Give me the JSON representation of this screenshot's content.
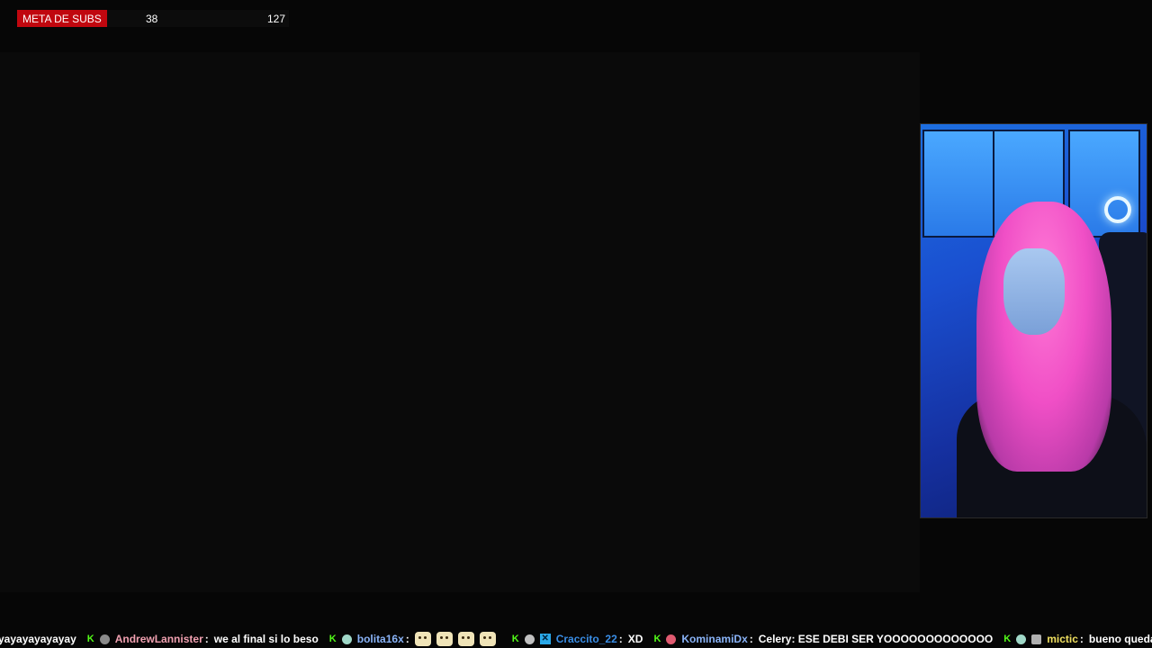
{
  "subgoal": {
    "label": "META DE SUBS",
    "current": "38",
    "target": "127",
    "progress_fraction": 0.3,
    "accent_color": "#c0070f"
  },
  "webcam": {
    "icon": "webcam-feed"
  },
  "chat": {
    "messages": [
      {
        "text": "yayayayayayay"
      },
      {
        "badges": [
          "kick-badge",
          "avatar-badge"
        ],
        "user": "AndrewLannister",
        "user_color": "#f0a0b0",
        "text": "we al final si lo beso"
      },
      {
        "badges": [
          "kick-badge",
          "globe-badge"
        ],
        "user": "bolita16x",
        "user_color": "#8ab4f8",
        "emotes": [
          "face-emote",
          "face-emote",
          "face-emote",
          "face-emote"
        ],
        "text": ""
      },
      {
        "badges": [
          "kick-badge",
          "sub-badge",
          "x-badge"
        ],
        "user": "Craccito_22",
        "user_color": "#3a8ee6",
        "text": "XD"
      },
      {
        "badges": [
          "kick-badge",
          "red-badge"
        ],
        "user": "KominamiDx",
        "user_color": "#8ab4f8",
        "text": "Celery: ESE DEBI SER YOOOOOOOOOOOOO"
      },
      {
        "badges": [
          "kick-badge",
          "globe-badge",
          "chess-badge"
        ],
        "user": "mictic",
        "user_color": "#f0e060",
        "text": "bueno quedar"
      }
    ]
  }
}
